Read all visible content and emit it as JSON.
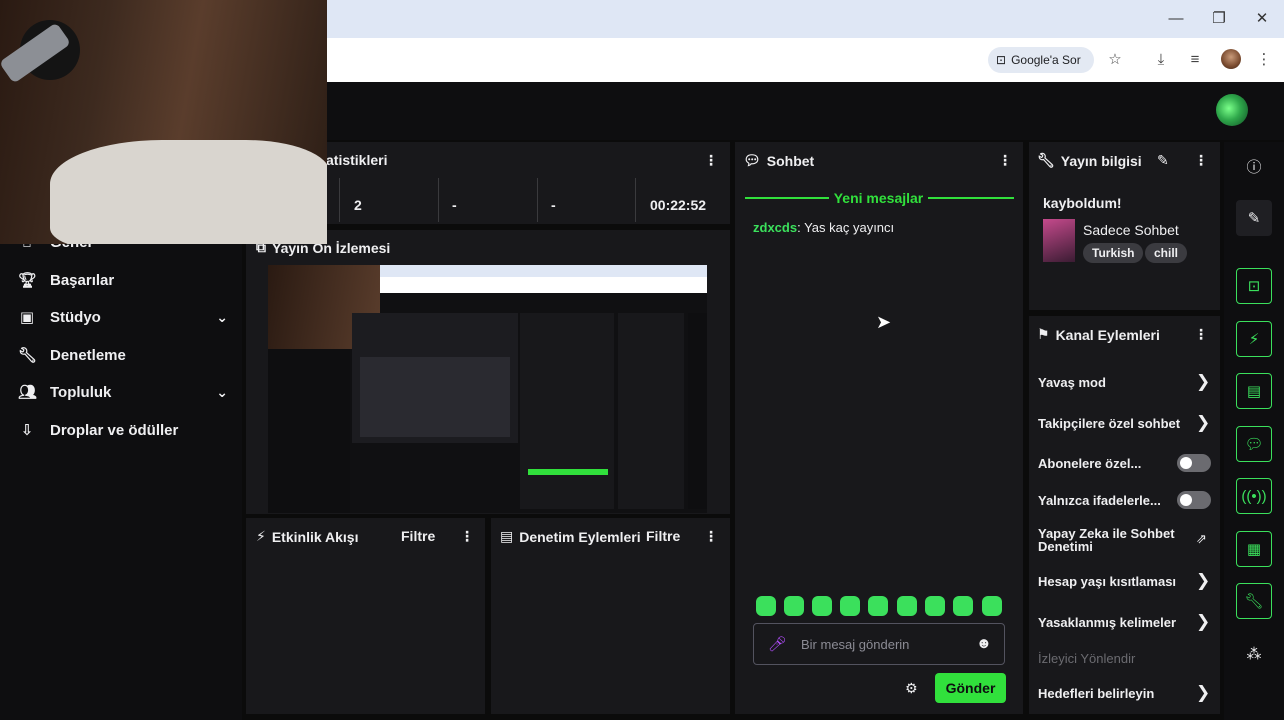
{
  "browser": {
    "search_chip": "Google'a Sor",
    "controls": [
      "minimize-icon",
      "restore-icon",
      "close-icon"
    ]
  },
  "sidebar": {
    "items": [
      {
        "label": "Genel",
        "icon": "home-icon"
      },
      {
        "label": "Başarılar",
        "icon": "trophy-icon"
      },
      {
        "label": "Stüdyo",
        "icon": "studio-icon",
        "expandable": true
      },
      {
        "label": "Denetleme",
        "icon": "wrench-icon"
      },
      {
        "label": "Topluluk",
        "icon": "people-icon",
        "expandable": true
      },
      {
        "label": "Droplar ve ödüller",
        "icon": "drops-icon"
      }
    ]
  },
  "stats": {
    "title": "atistikleri",
    "values": [
      "2",
      "-",
      "-",
      "00:22:52"
    ]
  },
  "preview": {
    "title": "Yayın Ön İzlemesi"
  },
  "activity": {
    "title": "Etkinlik Akışı",
    "filter": "Filtre"
  },
  "moderation": {
    "title": "Denetim Eylemleri",
    "filter": "Filtre"
  },
  "chat": {
    "title": "Sohbet",
    "new_messages": "Yeni mesajlar",
    "messages": [
      {
        "user": "zdxcds",
        "text": "Yas kaç yayıncı"
      }
    ],
    "input_placeholder": "Bir mesaj gönderin",
    "send_label": "Gönder",
    "user_color": "#3be05c"
  },
  "stream_info": {
    "title": "Yayın bilgisi",
    "stream_title": "kayboldum!",
    "category": "Sadece Sohbet",
    "tags": [
      "Turkish",
      "chill"
    ]
  },
  "channel_actions": {
    "title": "Kanal Eylemleri",
    "items": [
      {
        "label": "Yavaş mod",
        "control": "chevron"
      },
      {
        "label": "Takipçilere özel sohbet",
        "control": "chevron"
      },
      {
        "label": "Abonelere özel...",
        "control": "toggle",
        "on": false
      },
      {
        "label": "Yalnızca ifadelerle...",
        "control": "toggle",
        "on": false
      },
      {
        "label": "Yapay Zeka ile Sohbet Denetimi",
        "control": "external"
      },
      {
        "label": "Hesap yaşı kısıtlaması",
        "control": "chevron"
      },
      {
        "label": "Yasaklanmış kelimeler",
        "control": "chevron"
      },
      {
        "label": "İzleyici Yönlendir",
        "control": "none",
        "disabled": true
      },
      {
        "label": "Hedefleri belirleyin",
        "control": "chevron"
      }
    ]
  },
  "theme": {
    "accent": "#31e03c",
    "panel": "#18181b",
    "background": "#0e0e10"
  }
}
